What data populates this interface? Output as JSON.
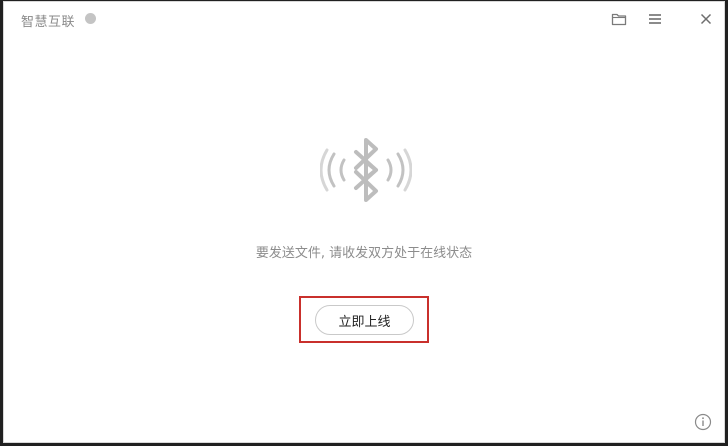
{
  "window": {
    "title": "智慧互联",
    "status_color": "#c4c4c4"
  },
  "toolbar": {
    "folder_icon": "folder-icon",
    "menu_icon": "menu-icon",
    "close_icon": "close-icon"
  },
  "main": {
    "illustration_icon": "bluetooth-icon",
    "hint": "要发送文件, 请收发双方处于在线状态",
    "online_button_label": "立即上线"
  },
  "footer": {
    "info_icon": "info-icon"
  },
  "colors": {
    "highlight_border": "#c9302c",
    "icon_gray": "#bdbdbd",
    "text_gray": "#8c8c8c"
  }
}
